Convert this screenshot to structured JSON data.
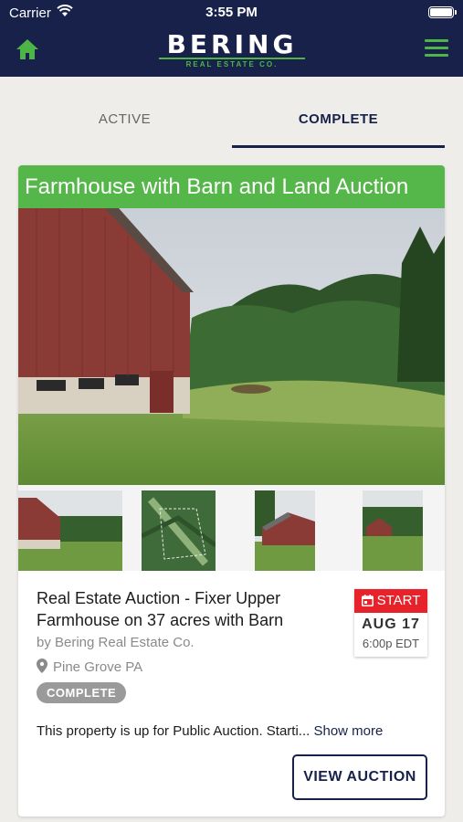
{
  "status_bar": {
    "carrier": "Carrier",
    "time": "3:55 PM"
  },
  "header": {
    "logo_main": "BERING",
    "logo_sub": "REAL ESTATE CO.",
    "home_icon": "home-icon",
    "menu_icon": "hamburger-menu-icon",
    "colors": {
      "bar": "#17214a",
      "accent": "#4db548"
    }
  },
  "tabs": [
    {
      "label": "ACTIVE",
      "selected": false
    },
    {
      "label": "COMPLETE",
      "selected": true
    }
  ],
  "listing": {
    "banner_title": "Farmhouse with Barn and Land Auction",
    "carousel": {
      "total_slides": 10,
      "current_slide": 1
    },
    "thumbnails": [
      "barn-photo",
      "aerial-map-photo",
      "barn-photo",
      "barn-photo"
    ],
    "title": "Real Estate Auction - Fixer Upper Farmhouse on 37 acres with Barn",
    "byline": "by Bering Real Estate Co.",
    "location": "Pine Grove PA",
    "status": "COMPLETE",
    "date": {
      "label": "START",
      "day": "AUG 17",
      "time": "6:00p EDT"
    },
    "description": "This property is up for Public Auction. Starti...",
    "show_more": "Show more",
    "cta": "VIEW AUCTION",
    "colors": {
      "banner": "#55b649",
      "start": "#e8222a",
      "badge": "#9a9a9a"
    }
  }
}
